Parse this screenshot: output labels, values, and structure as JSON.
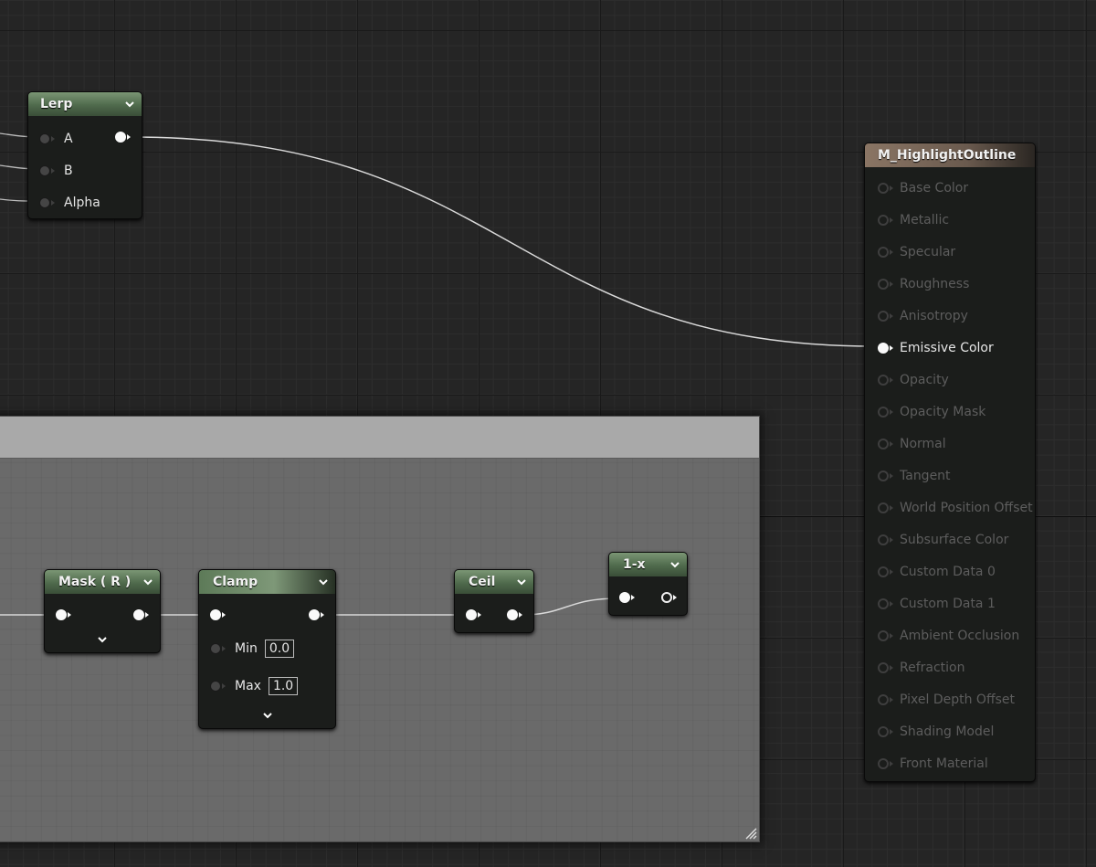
{
  "lerp": {
    "title": "Lerp",
    "inputs": [
      "A",
      "B",
      "Alpha"
    ]
  },
  "mask_node": {
    "title": "Mask ( R )"
  },
  "clamp_node": {
    "title": "Clamp",
    "min_label": "Min",
    "min_value": "0.0",
    "max_label": "Max",
    "max_value": "1.0"
  },
  "ceil_node": {
    "title": "Ceil"
  },
  "one_minus_node": {
    "title": "1-x"
  },
  "result_node": {
    "title": "M_HighlightOutline",
    "pins": [
      "Base Color",
      "Metallic",
      "Specular",
      "Roughness",
      "Anisotropy",
      "Emissive Color",
      "Opacity",
      "Opacity Mask",
      "Normal",
      "Tangent",
      "World Position Offset",
      "Subsurface Color",
      "Custom Data 0",
      "Custom Data 1",
      "Ambient Occlusion",
      "Refraction",
      "Pixel Depth Offset",
      "Shading Model",
      "Front Material"
    ],
    "connected_pin": "Emissive Color"
  },
  "colors": {
    "canvas": "#252525",
    "comment_body": "#6a6a6a",
    "comment_header": "#a9a9a9",
    "node_header_green": "#5d7a58",
    "result_header": "#8a7564",
    "wire": "#d9d9d9"
  }
}
